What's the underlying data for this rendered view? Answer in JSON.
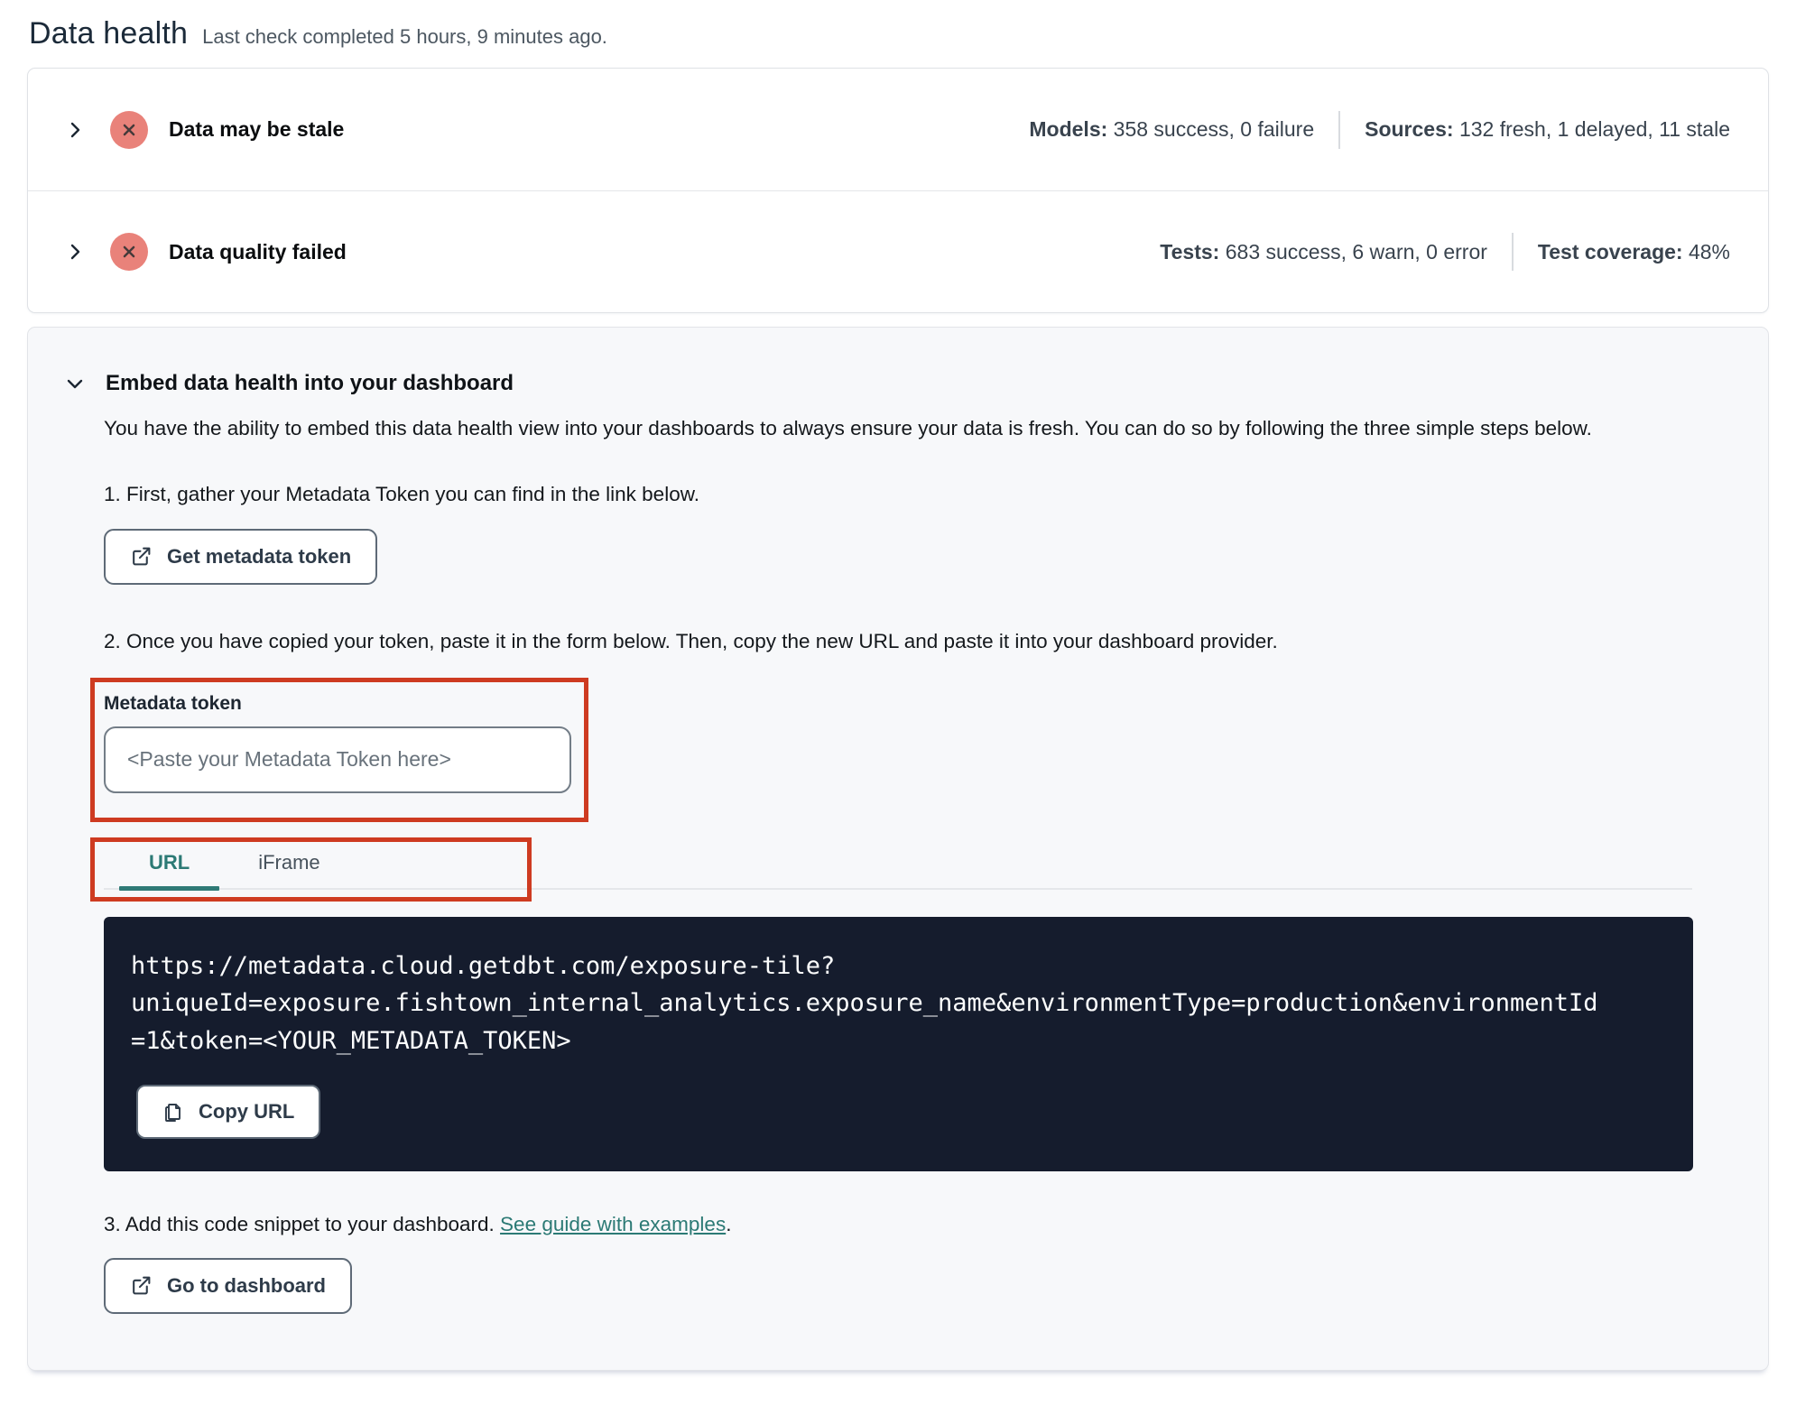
{
  "page": {
    "title": "Data health",
    "subtitle": "Last check completed 5 hours, 9 minutes ago."
  },
  "status_panel": {
    "rows": [
      {
        "title": "Data may be stale",
        "status_icon": "x-circle-error",
        "stats": [
          {
            "label": "Models:",
            "value": "358 success, 0 failure"
          },
          {
            "label": "Sources:",
            "value": "132 fresh, 1 delayed, 11 stale"
          }
        ]
      },
      {
        "title": "Data quality failed",
        "status_icon": "x-circle-error",
        "stats": [
          {
            "label": "Tests:",
            "value": "683 success, 6 warn, 0 error"
          },
          {
            "label": "Test coverage:",
            "value": "48%"
          }
        ]
      }
    ]
  },
  "embed": {
    "title": "Embed data health into your dashboard",
    "description": "You have the ability to embed this data health view into your dashboards to always ensure your data is fresh. You can do so by following the three simple steps below.",
    "step_1": "1. First, gather your Metadata Token you can find in the link below.",
    "get_token_button": "Get metadata token",
    "step_2": "2. Once you have copied your token, paste it in the form below. Then, copy the new URL and paste it into your dashboard provider.",
    "token_field": {
      "label": "Metadata token",
      "value": "",
      "placeholder": "<Paste your Metadata Token here>"
    },
    "tabs": [
      {
        "label": "URL",
        "active": true
      },
      {
        "label": "iFrame",
        "active": false
      }
    ],
    "code": {
      "lines": [
        "https://metadata.cloud.getdbt.com/exposure-tile?",
        "uniqueId=exposure.fishtown_internal_analytics.exposure_name&environmentType=production&environmentId",
        "=1&token=<YOUR_METADATA_TOKEN>"
      ]
    },
    "copy_url_button": "Copy URL",
    "step_3": {
      "prefix": "3. Add this code snippet to your dashboard. ",
      "link": "See guide with examples",
      "suffix": "."
    },
    "dashboard_button": "Go to dashboard"
  },
  "colors": {
    "annotation_red": "#ce3b21",
    "teal_accent": "#2f7a76",
    "error_salmon": "#e9827a",
    "code_background": "#151c2d"
  }
}
